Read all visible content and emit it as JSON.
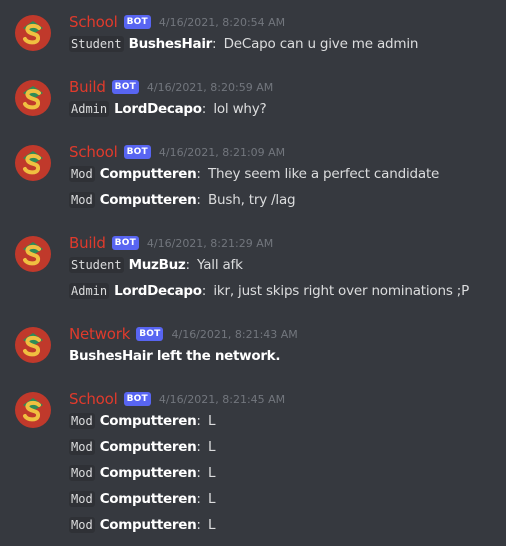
{
  "colors": {
    "background": "#36393f",
    "author_red": "#e03a2c",
    "bot_tag": "#5865f2",
    "timestamp": "#72767d"
  },
  "bot_tag": "BOT",
  "groups": [
    {
      "author": "School",
      "timestamp": "4/16/2021, 8:20:54 AM",
      "messages": [
        {
          "role": "Student",
          "user": "BushesHair",
          "text": "DeCapo can u give me admin"
        }
      ]
    },
    {
      "author": "Build",
      "timestamp": "4/16/2021, 8:20:59 AM",
      "messages": [
        {
          "role": "Admin",
          "user": "LordDecapo",
          "text": "lol why?"
        }
      ]
    },
    {
      "author": "School",
      "timestamp": "4/16/2021, 8:21:09 AM",
      "messages": [
        {
          "role": "Mod",
          "user": "Computteren",
          "text": "They seem like a perfect candidate"
        },
        {
          "role": "Mod",
          "user": "Computteren",
          "text": "Bush, try /lag"
        }
      ]
    },
    {
      "author": "Build",
      "timestamp": "4/16/2021, 8:21:29 AM",
      "messages": [
        {
          "role": "Student",
          "user": "MuzBuz",
          "text": "Yall afk"
        },
        {
          "role": "Admin",
          "user": "LordDecapo",
          "text": "ikr, just skips right over nominations ;P"
        }
      ]
    },
    {
      "author": "Network",
      "timestamp": "4/16/2021, 8:21:43 AM",
      "messages": [
        {
          "plain": "BushesHair left the network."
        }
      ]
    },
    {
      "author": "School",
      "timestamp": "4/16/2021, 8:21:45 AM",
      "messages": [
        {
          "role": "Mod",
          "user": "Computteren",
          "text": "L"
        },
        {
          "role": "Mod",
          "user": "Computteren",
          "text": "L"
        },
        {
          "role": "Mod",
          "user": "Computteren",
          "text": "L"
        },
        {
          "role": "Mod",
          "user": "Computteren",
          "text": "L"
        },
        {
          "role": "Mod",
          "user": "Computteren",
          "text": "L"
        }
      ]
    }
  ]
}
